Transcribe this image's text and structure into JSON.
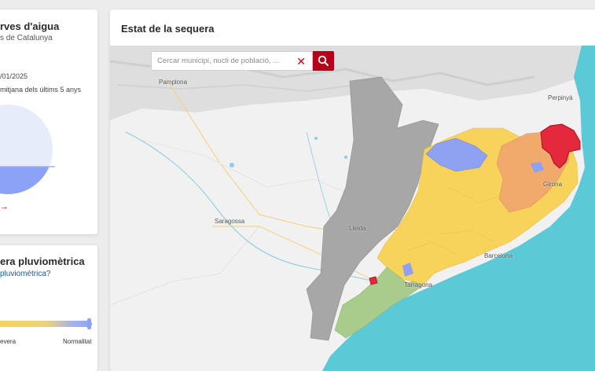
{
  "reserves": {
    "title": "rves d'aigua",
    "subtitle": "s de Catalunya",
    "date": "/01/2025",
    "note": "mitjana dels últims 5 anys",
    "arrow": "→",
    "fill_level_percent": 30
  },
  "sequera": {
    "title": "era pluviomètrica",
    "link": "pluviomètrica?",
    "scale_min_label": "evera",
    "scale_max_label": "Normalitat"
  },
  "map": {
    "title": "Estat de la sequera",
    "search": {
      "placeholder": "Cercar municipi, nucli de població, ..."
    },
    "icons": {
      "clear": "close-icon",
      "search": "search-icon"
    },
    "labels": {
      "pamplona": "Pamplona",
      "perpinya": "Perpinyà",
      "saragossa": "Saragossa",
      "lleida": "Lleida",
      "girona": "Girona",
      "barcelona": "Barcelona",
      "tarragona": "Tarragona"
    },
    "legend_colors": {
      "emergencia": "#e3293b",
      "excepcionalitat": "#f0a86c",
      "alerta": "#f7d35b",
      "prealerta": "#a9cc8c",
      "normalitat": "#8fa2f2",
      "sea": "#5ccad6",
      "outside": "#a7a7a7"
    }
  }
}
